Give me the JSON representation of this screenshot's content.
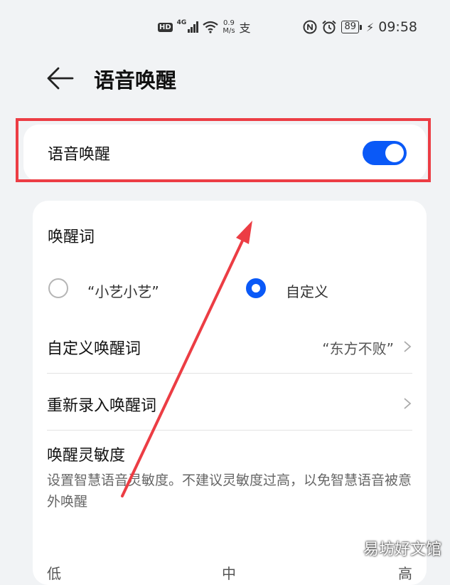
{
  "status_bar": {
    "hd": "HD",
    "network": "4G",
    "speed_value": "0.9",
    "speed_unit": "M/s",
    "pay_glyph": "支",
    "battery": "89",
    "time": "09:58",
    "icons": [
      "signal-icon",
      "wifi-icon",
      "alipay-icon",
      "nfc-icon",
      "alarm-icon",
      "battery-icon",
      "charging-icon"
    ]
  },
  "header": {
    "title": "语音唤醒",
    "back_icon": "back-arrow-icon"
  },
  "voice_wake_card": {
    "label": "语音唤醒",
    "toggle_on": true,
    "accent_color": "#0a59f7"
  },
  "wake_word_card": {
    "section_title": "唤醒词",
    "options": [
      {
        "label": "“小艺小艺”",
        "selected": false
      },
      {
        "label": "自定义",
        "selected": true
      }
    ],
    "custom_word_row": {
      "label": "自定义唤醒词",
      "value": "“东方不败”"
    },
    "re_record_row": {
      "label": "重新录入唤醒词"
    },
    "sensitivity": {
      "title": "唤醒灵敏度",
      "description": "设置智慧语音灵敏度。不建议灵敏度过高，以免智慧语音被意外唤醒",
      "levels": [
        "低",
        "中",
        "高"
      ]
    }
  },
  "annotation": {
    "highlight_color": "#ec3d44"
  },
  "watermark": "易坊好文馆"
}
